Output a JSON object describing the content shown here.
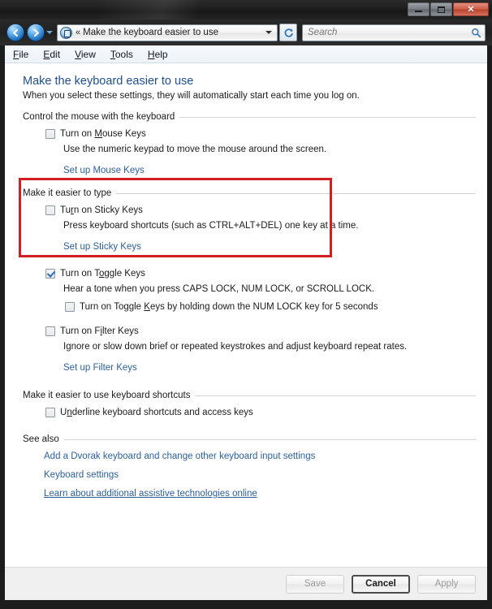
{
  "window": {
    "controls": {
      "minimize": "Minimize",
      "maximize": "Maximize",
      "close": "✕"
    }
  },
  "navbar": {
    "back": "Back",
    "forward": "Forward",
    "history": "Recent pages",
    "breadcrumb_separator": "«",
    "breadcrumb": "Make the keyboard easier to use",
    "refresh": "Refresh",
    "search": {
      "placeholder": "Search",
      "value": ""
    }
  },
  "menubar": {
    "items": [
      {
        "prefix": "F",
        "rest": "ile"
      },
      {
        "prefix": "E",
        "rest": "dit"
      },
      {
        "prefix": "V",
        "rest": "iew"
      },
      {
        "prefix": "T",
        "rest": "ools"
      },
      {
        "prefix": "H",
        "rest": "elp"
      }
    ]
  },
  "page": {
    "title": "Make the keyboard easier to use",
    "subtitle": "When you select these settings, they will automatically start each time you log on."
  },
  "sections": {
    "mouse": {
      "heading": "Control the mouse with the keyboard",
      "checkbox_label_pre": "Turn on ",
      "checkbox_label_accel": "M",
      "checkbox_label_post": "ouse Keys",
      "checked": false,
      "description": "Use the numeric keypad to move the mouse around the screen.",
      "link": "Set up Mouse Keys"
    },
    "type": {
      "heading": "Make it easier to type",
      "sticky": {
        "label_pre": "Tu",
        "label_accel": "r",
        "label_post": "n on Sticky Keys",
        "checked": false,
        "description": "Press keyboard shortcuts (such as CTRL+ALT+DEL) one key at a time.",
        "link": "Set up Sticky Keys"
      },
      "toggle": {
        "label_pre": "Turn on T",
        "label_accel": "o",
        "label_post": "ggle Keys",
        "checked": true,
        "description": "Hear a tone when you press CAPS LOCK, NUM LOCK, or SCROLL LOCK.",
        "sub_label_pre": "Turn on Toggle ",
        "sub_label_accel": "K",
        "sub_label_post": "eys by holding down the NUM LOCK key for 5 seconds",
        "sub_checked": false
      },
      "filter": {
        "label_pre": "Turn on F",
        "label_accel": "i",
        "label_post": "lter Keys",
        "checked": false,
        "description": "Ignore or slow down brief or repeated keystrokes and adjust keyboard repeat rates.",
        "link": "Set up Filter Keys"
      }
    },
    "shortcuts": {
      "heading": "Make it easier to use keyboard shortcuts",
      "underline": {
        "label_pre": "U",
        "label_accel": "n",
        "label_post": "derline keyboard shortcuts and access keys",
        "checked": false
      }
    },
    "see_also": {
      "heading": "See also",
      "links": [
        {
          "text": "Add a Dvorak keyboard and change other keyboard input settings",
          "underlined": false
        },
        {
          "text": "Keyboard settings",
          "underlined": false
        },
        {
          "text": "Learn about additional assistive technologies online",
          "underlined": true
        }
      ]
    }
  },
  "footer": {
    "save": {
      "label": "Save",
      "disabled": true
    },
    "cancel": {
      "label": "Cancel",
      "disabled": false
    },
    "apply": {
      "label": "Apply",
      "disabled": true
    }
  },
  "annotation": {
    "highlight_color": "#d21f22",
    "target": "Control the mouse with the keyboard"
  }
}
